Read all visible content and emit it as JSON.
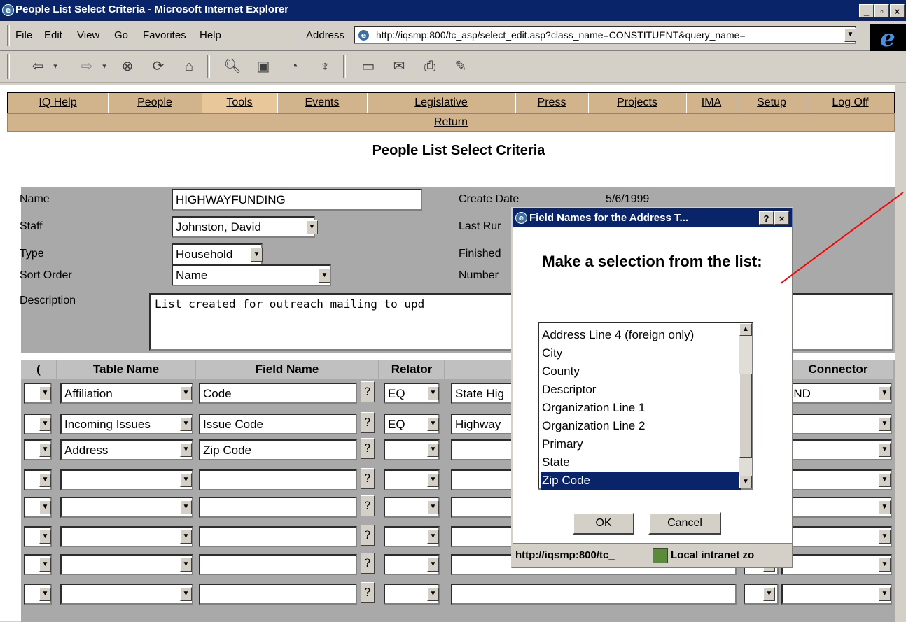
{
  "window": {
    "title": "People List Select Criteria - Microsoft Internet Explorer",
    "controls": {
      "minimize": "_",
      "maximize": "▫",
      "close": "×"
    }
  },
  "menu": {
    "items": [
      "File",
      "Edit",
      "View",
      "Go",
      "Favorites",
      "Help"
    ],
    "address_label": "Address",
    "address_url": "http://iqsmp:800/tc_asp/select_edit.asp?class_name=CONSTITUENT&query_name="
  },
  "nav": {
    "items": [
      "IQ Help",
      "People",
      "Tools",
      "Events",
      "Legislative",
      "Press",
      "Projects",
      "IMA",
      "Setup",
      "Log Off"
    ],
    "return": "Return"
  },
  "page": {
    "title": "People List Select Criteria"
  },
  "form": {
    "name_label": "Name",
    "name_value": "HIGHWAYFUNDING",
    "staff_label": "Staff",
    "staff_value": "Johnston, David",
    "type_label": "Type",
    "type_value": "Household",
    "sort_label": "Sort Order",
    "sort_value": "Name",
    "description_label": "Description",
    "description_value": "List created for outreach mailing to upd",
    "create_date_label": "Create Date",
    "create_date_value": "5/6/1999",
    "last_run_label": "Last Rur",
    "finished_label": "Finished",
    "number_label": "Number"
  },
  "grid": {
    "headers": {
      "paren": "(",
      "table": "Table Name",
      "field": "Field Name",
      "relator": "Relator",
      "connector": "Connector"
    },
    "question": "?",
    "rows": [
      {
        "table": "Affiliation",
        "field": "Code",
        "relator": "EQ",
        "value": "State Hig",
        "connector": "AND"
      },
      {
        "table": "Incoming Issues",
        "field": "Issue Code",
        "relator": "EQ",
        "value": "Highway",
        "connector": ""
      },
      {
        "table": "Address",
        "field": "Zip Code",
        "relator": "",
        "value": "",
        "connector": ""
      },
      {
        "table": "",
        "field": "",
        "relator": "",
        "value": "",
        "connector": ""
      },
      {
        "table": "",
        "field": "",
        "relator": "",
        "value": "",
        "connector": ""
      },
      {
        "table": "",
        "field": "",
        "relator": "",
        "value": "",
        "connector": ""
      },
      {
        "table": "",
        "field": "",
        "relator": "",
        "value": "",
        "connector": ""
      },
      {
        "table": "",
        "field": "",
        "relator": "",
        "value": "",
        "connector": ""
      }
    ]
  },
  "dialog": {
    "title": "Field Names for the Address T...",
    "heading": "Make a selection from the list:",
    "options": [
      "Address Line 4 (foreign only)",
      "City",
      "County",
      "Descriptor",
      "Organization Line 1",
      "Organization Line 2",
      "Primary",
      "State",
      "Zip Code"
    ],
    "selected": "Zip Code",
    "ok": "OK",
    "cancel": "Cancel",
    "status_url": "http://iqsmp:800/tc_",
    "status_zone": "Local intranet zo"
  },
  "colors": {
    "titlebar": "#0a246a",
    "nav": "#d2b48c",
    "panel": "#a9a9a9",
    "annotation": "#ff0000"
  }
}
